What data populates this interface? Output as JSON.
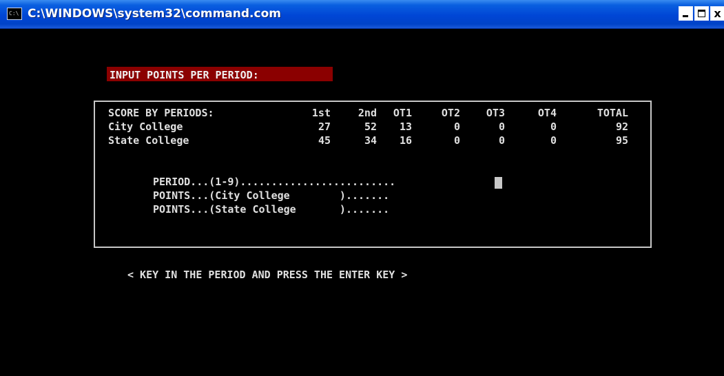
{
  "window": {
    "title": "C:\\WINDOWS\\system32\\command.com",
    "icon_label": "C:\\",
    "icon": "console-icon",
    "buttons": {
      "minimize": "minimize-icon",
      "maximize": "maximize-icon",
      "close_label": "x"
    }
  },
  "header": {
    "label": "INPUT POINTS PER PERIOD:",
    "highlight_color": "#8b0000"
  },
  "scoreboard": {
    "title": "SCORE BY PERIODS:",
    "columns": [
      "1st",
      "2nd",
      "OT1",
      "OT2",
      "OT3",
      "OT4",
      "TOTAL"
    ],
    "rows": [
      {
        "team": "City College",
        "scores": [
          "27",
          "52",
          "13",
          "0",
          "0",
          "0",
          "92"
        ]
      },
      {
        "team": "State College",
        "scores": [
          "45",
          "34",
          "16",
          "0",
          "0",
          "0",
          "95"
        ]
      }
    ]
  },
  "prompts": {
    "period": "PERIOD...(1-9).........................",
    "points_city": "POINTS...(City College        ).......",
    "points_state": "POINTS...(State College       )......."
  },
  "instruction": "< KEY IN THE PERIOD AND PRESS THE ENTER KEY >"
}
